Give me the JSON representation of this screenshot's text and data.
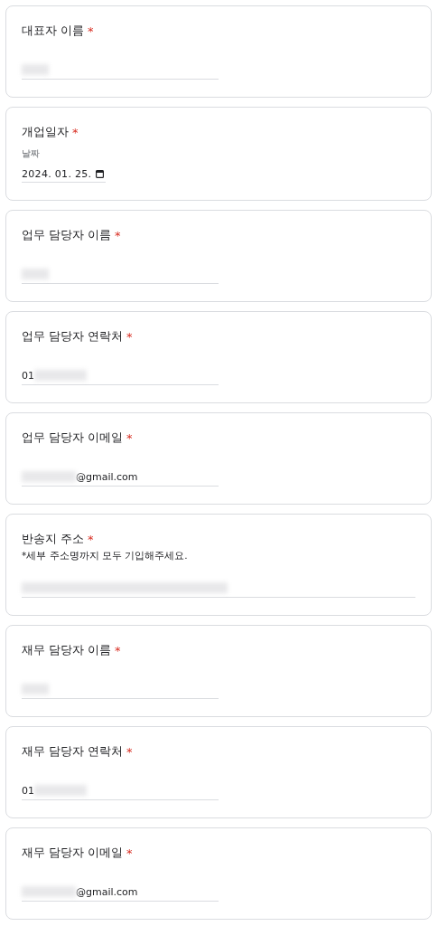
{
  "questions": [
    {
      "title": "대표자 이름",
      "required_mark": "*",
      "answer": {
        "kind": "name",
        "redacted": true
      }
    },
    {
      "title": "개업일자",
      "required_mark": "*",
      "answer": {
        "kind": "date",
        "label": "날짜",
        "text": "2024. 01. 25."
      }
    },
    {
      "title": "업무 담당자 이름",
      "required_mark": "*",
      "answer": {
        "kind": "name",
        "redacted": true
      }
    },
    {
      "title": "업무 담당자 연락처",
      "required_mark": "*",
      "answer": {
        "kind": "phone",
        "text": "01",
        "redacted": true
      }
    },
    {
      "title": "업무 담당자 이메일",
      "required_mark": "*",
      "answer": {
        "kind": "email",
        "text": "@gmail.com",
        "redacted": true
      }
    },
    {
      "title": "반송지 주소",
      "required_mark": "*",
      "description": "*세부 주소명까지 모두 기입해주세요.",
      "answer": {
        "kind": "address",
        "redacted": true
      }
    },
    {
      "title": "재무 담당자 이름",
      "required_mark": "*",
      "answer": {
        "kind": "name",
        "redacted": true
      }
    },
    {
      "title": "재무 담당자 연락처",
      "required_mark": "*",
      "answer": {
        "kind": "phone",
        "text": "01",
        "redacted": true
      }
    },
    {
      "title": "재무 담당자 이메일",
      "required_mark": "*",
      "answer": {
        "kind": "email",
        "text": "@gmail.com",
        "redacted": true
      }
    }
  ]
}
